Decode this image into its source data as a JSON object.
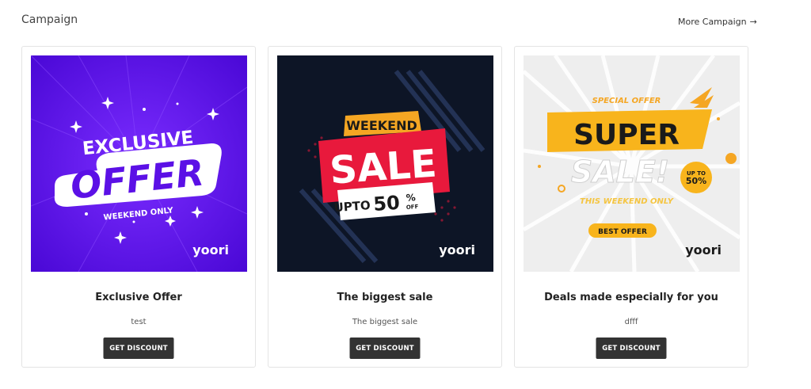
{
  "section": {
    "title": "Campaign",
    "more_label": "More Campaign",
    "more_arrow": "→"
  },
  "campaigns": [
    {
      "title": "Exclusive Offer",
      "description": "test",
      "button_label": "GET DISCOUNT",
      "banner": {
        "background": "#5b10e6",
        "line1": "EXCLUSIVE",
        "line2": "OFFER",
        "line3": "WEEKEND ONLY",
        "brand": "yoori"
      }
    },
    {
      "title": "The biggest sale",
      "description": "The biggest sale",
      "button_label": "GET DISCOUNT",
      "banner": {
        "background": "#0d1526",
        "line1": "WEEKEND",
        "line2": "SALE",
        "line3a": "UPTO",
        "line3b": "50",
        "line3c": "%",
        "line3d": "OFF",
        "brand": "yoori"
      }
    },
    {
      "title": "Deals made especially for you",
      "description": "dfff",
      "button_label": "GET DISCOUNT",
      "banner": {
        "background": "#eeeeee",
        "line0": "SPECIAL OFFER",
        "line1": "SUPER",
        "line2": "SALE!",
        "badge_top": "UP TO",
        "badge_bottom": "50%",
        "line3": "THIS WEEKEND ONLY",
        "pill": "BEST OFFER",
        "brand": "yoori"
      }
    }
  ]
}
